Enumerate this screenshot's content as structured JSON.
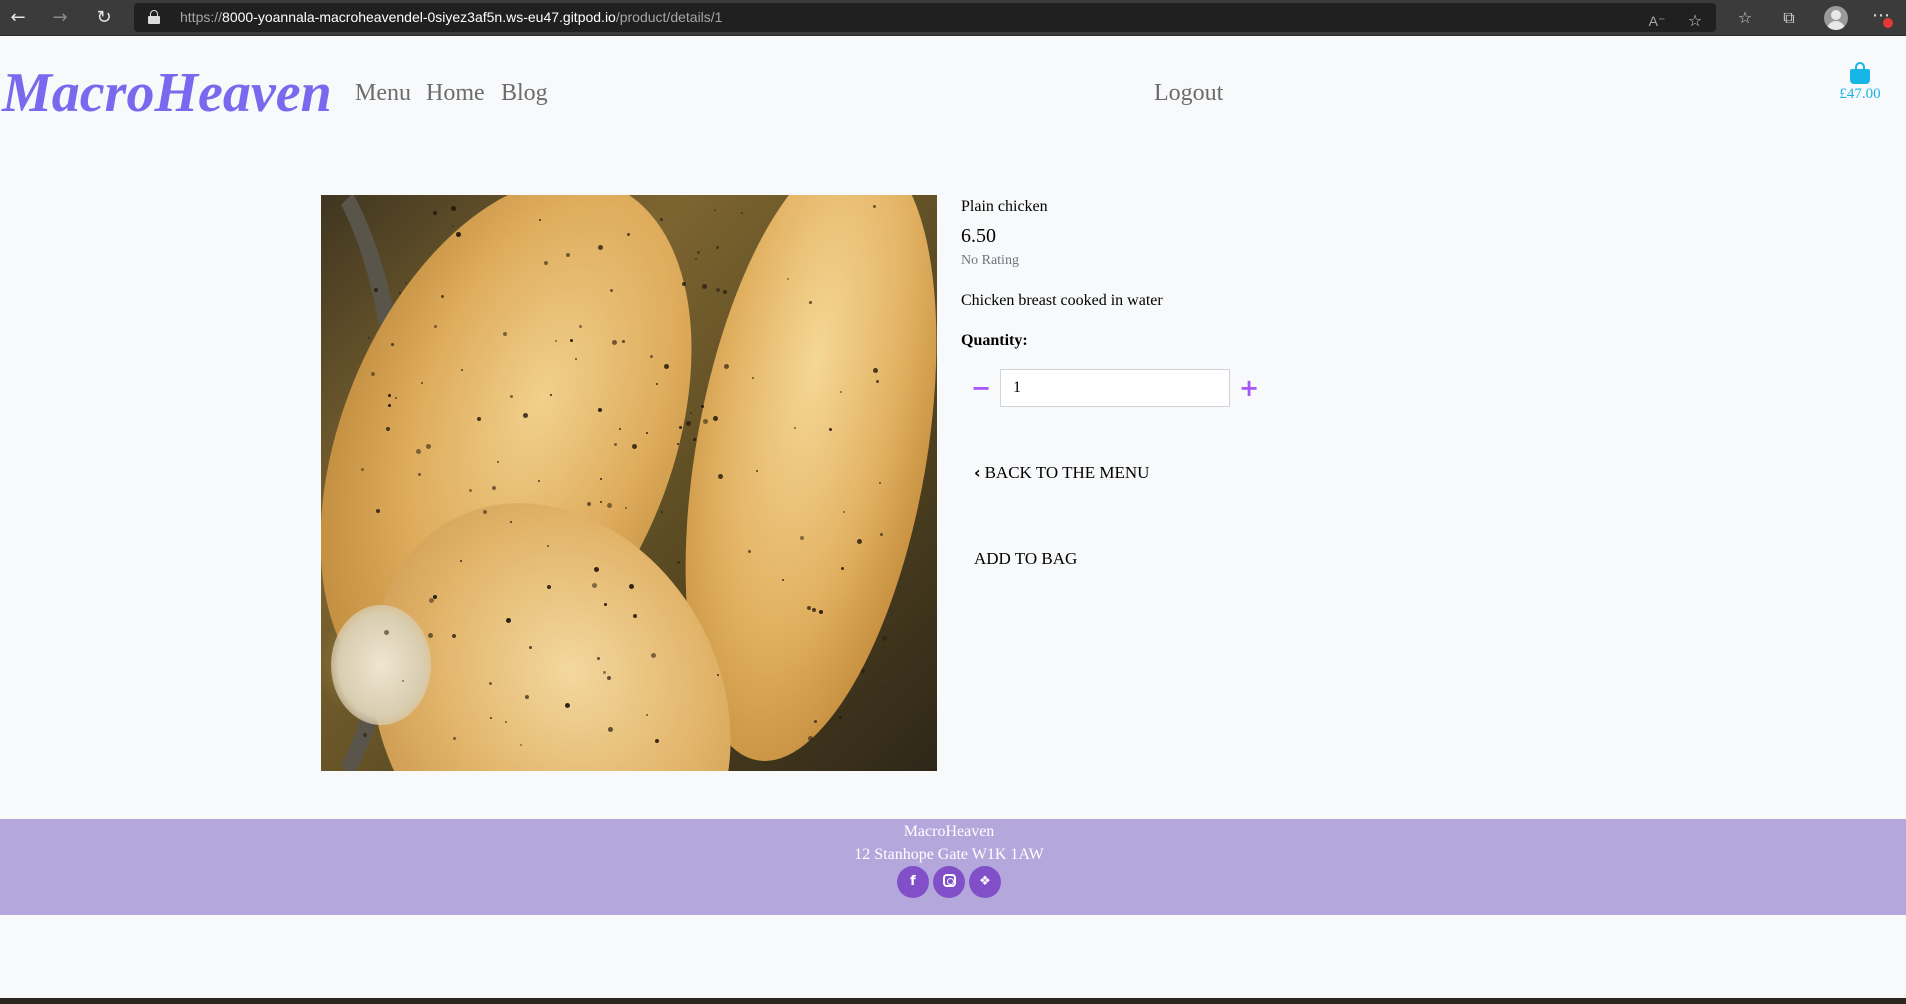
{
  "browser": {
    "url_scheme": "https://",
    "url_host": "8000-yoannala-macroheavendel-0siyez3af5n.ws-eu47.gitpod.io",
    "url_path": "/product/details/1",
    "icons": [
      "back-arrow-icon",
      "forward-arrow-icon",
      "reload-icon",
      "lock-icon",
      "read-aloud-icon",
      "add-favorite-icon",
      "favorites-icon",
      "collections-icon",
      "profile-icon",
      "more-menu-icon"
    ]
  },
  "header": {
    "brand": "MacroHeaven",
    "nav": [
      "Menu",
      "Home",
      "Blog"
    ],
    "logout": "Logout",
    "bag_total": "£47.00",
    "colors": {
      "brand": "#7b68ee",
      "bag": "#17b6e6",
      "nav": "#6c6c6c"
    }
  },
  "product": {
    "image_alt": "Plain chicken",
    "name": "Plain chicken",
    "price": "6.50",
    "rating": "No Rating",
    "description": "Chicken breast cooked in water",
    "quantity_label": "Quantity:",
    "quantity": "1",
    "back_label": "BACK TO THE MENU",
    "add_label": "ADD TO BAG",
    "colors": {
      "qty_buttons": "#a855f7"
    }
  },
  "footer": {
    "name": "MacroHeaven",
    "address": "12 Stanhope Gate W1K 1AW",
    "social": [
      "facebook-icon",
      "instagram-icon",
      "twitter-icon"
    ],
    "colors": {
      "background": "#b3a7dc",
      "social": "#8150c9"
    }
  }
}
